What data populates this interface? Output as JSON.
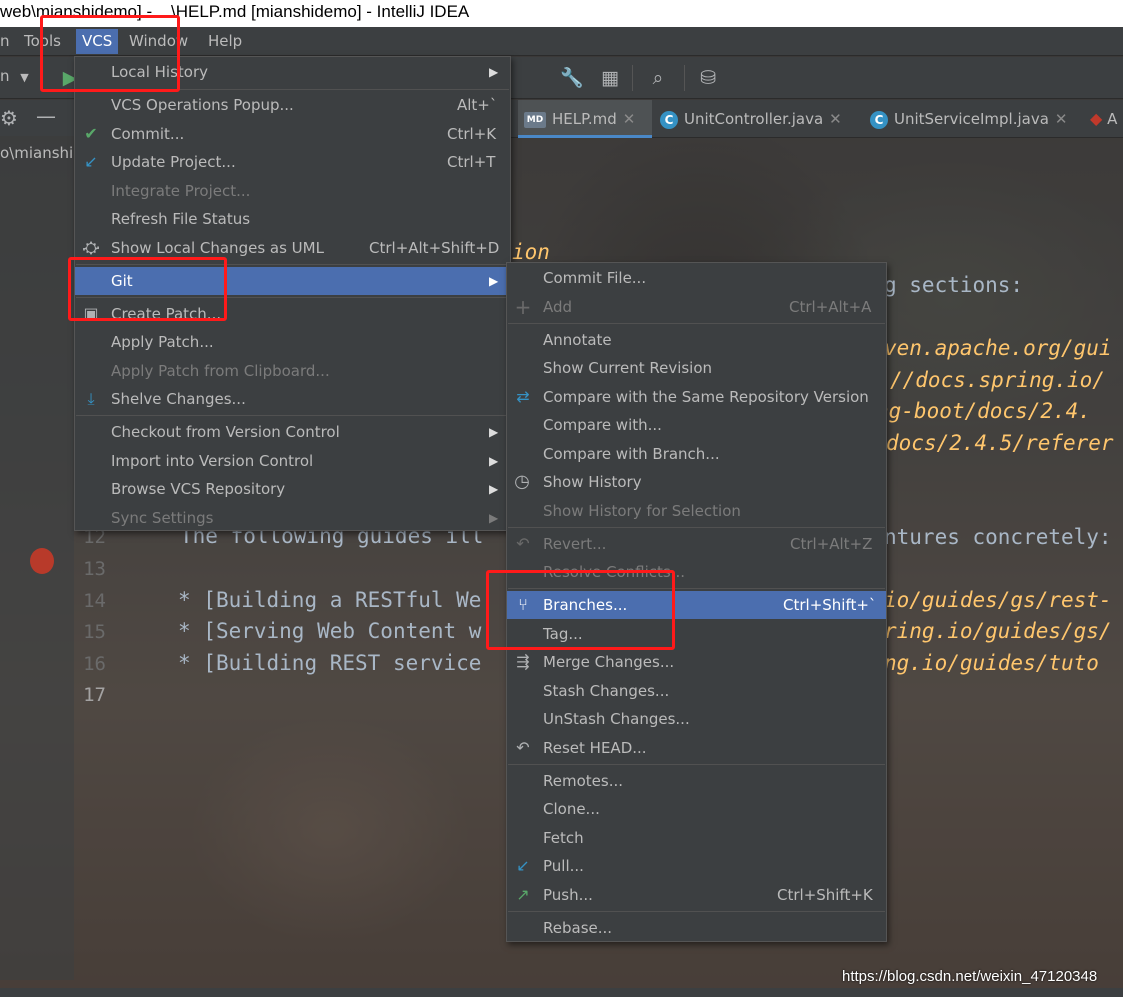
{
  "window": {
    "title": "web\\mianshidemo] - ...\\HELP.md [mianshidemo] - IntelliJ IDEA"
  },
  "menubar": {
    "items": [
      {
        "label": "n"
      },
      {
        "label": "Tools"
      },
      {
        "label": "VCS"
      },
      {
        "label": "Window"
      },
      {
        "label": "Help"
      }
    ]
  },
  "toolbar": {
    "config_label": "n"
  },
  "project_panel": {
    "path_text": "o\\mianshi"
  },
  "editor": {
    "tabs": [
      {
        "label": "HELP.md",
        "icon": "MD"
      },
      {
        "label": "UnitController.java",
        "icon": "C"
      },
      {
        "label": "UnitServiceImpl.java",
        "icon": "C"
      },
      {
        "label": "A"
      }
    ],
    "lines": [
      {
        "num": "12",
        "text": "The following guides ill"
      },
      {
        "num": "13",
        "text": ""
      },
      {
        "num": "14",
        "text": "[Building a RESTful We"
      },
      {
        "num": "15",
        "text": "[Serving Web Content w"
      },
      {
        "num": "16",
        "text": "[Building REST service"
      },
      {
        "num": "17",
        "text": ""
      }
    ],
    "right_fragments": [
      "ion",
      "g sections:",
      "ven.apache.org/gui",
      "//docs.spring.io/",
      "ng-boot/docs/2.4.",
      "docs/2.4.5/referer",
      "ntures concretely:",
      "io/guides/gs/rest-",
      "ring.io/guides/gs/",
      "ng.io/guides/tuto"
    ]
  },
  "vcs_menu": {
    "items": [
      {
        "label": "Local History",
        "shortcut": "",
        "submenu": true
      },
      {
        "label": "VCS Operations Popup...",
        "shortcut": "Alt+`"
      },
      {
        "label": "Commit...",
        "shortcut": "Ctrl+K",
        "icon": "check-icon"
      },
      {
        "label": "Update Project...",
        "shortcut": "Ctrl+T",
        "icon": "update-arrow-icon"
      },
      {
        "label": "Integrate Project...",
        "shortcut": "",
        "disabled": true
      },
      {
        "label": "Refresh File Status",
        "shortcut": ""
      },
      {
        "label": "Show Local Changes as UML",
        "shortcut": "Ctrl+Alt+Shift+D",
        "icon": "uml-icon"
      },
      {
        "label": "Git",
        "shortcut": "",
        "submenu": true,
        "highlight": true
      },
      {
        "label": "Create Patch...",
        "shortcut": "",
        "icon": "patch-icon"
      },
      {
        "label": "Apply Patch...",
        "shortcut": ""
      },
      {
        "label": "Apply Patch from Clipboard...",
        "shortcut": "",
        "disabled": true
      },
      {
        "label": "Shelve Changes...",
        "shortcut": "",
        "icon": "shelve-icon"
      },
      {
        "label": "Checkout from Version Control",
        "shortcut": "",
        "submenu": true
      },
      {
        "label": "Import into Version Control",
        "shortcut": "",
        "submenu": true
      },
      {
        "label": "Browse VCS Repository",
        "shortcut": "",
        "submenu": true
      },
      {
        "label": "Sync Settings",
        "shortcut": "",
        "submenu": true,
        "disabled": true
      }
    ]
  },
  "git_menu": {
    "items": [
      {
        "label": "Commit File...",
        "shortcut": ""
      },
      {
        "label": "Add",
        "shortcut": "Ctrl+Alt+A",
        "disabled": true,
        "icon": "plus-icon"
      },
      {
        "label": "Annotate",
        "shortcut": ""
      },
      {
        "label": "Show Current Revision",
        "shortcut": ""
      },
      {
        "label": "Compare with the Same Repository Version",
        "shortcut": "",
        "icon": "compare-icon"
      },
      {
        "label": "Compare with...",
        "shortcut": ""
      },
      {
        "label": "Compare with Branch...",
        "shortcut": ""
      },
      {
        "label": "Show History",
        "shortcut": "",
        "icon": "clock-icon"
      },
      {
        "label": "Show History for Selection",
        "shortcut": "",
        "disabled": true
      },
      {
        "label": "Revert...",
        "shortcut": "Ctrl+Alt+Z",
        "disabled": true,
        "icon": "revert-icon"
      },
      {
        "label": "Resolve Conflicts...",
        "shortcut": "",
        "disabled": true
      },
      {
        "label": "Branches...",
        "shortcut": "Ctrl+Shift+`",
        "highlight": true,
        "icon": "branch-icon"
      },
      {
        "label": "Tag...",
        "shortcut": ""
      },
      {
        "label": "Merge Changes...",
        "shortcut": "",
        "icon": "merge-icon"
      },
      {
        "label": "Stash Changes...",
        "shortcut": ""
      },
      {
        "label": "UnStash Changes...",
        "shortcut": ""
      },
      {
        "label": "Reset HEAD...",
        "shortcut": "",
        "icon": "reset-icon"
      },
      {
        "label": "Remotes...",
        "shortcut": ""
      },
      {
        "label": "Clone...",
        "shortcut": ""
      },
      {
        "label": "Fetch",
        "shortcut": ""
      },
      {
        "label": "Pull...",
        "shortcut": "",
        "icon": "pull-icon"
      },
      {
        "label": "Push...",
        "shortcut": "Ctrl+Shift+K",
        "icon": "push-icon"
      },
      {
        "label": "Rebase...",
        "shortcut": ""
      }
    ]
  },
  "watermark": "https://blog.csdn.net/weixin_47120348",
  "colors": {
    "highlight": "#4b6eaf",
    "menu_bg": "#3c3f41",
    "annotation": "#ff1a1a"
  }
}
